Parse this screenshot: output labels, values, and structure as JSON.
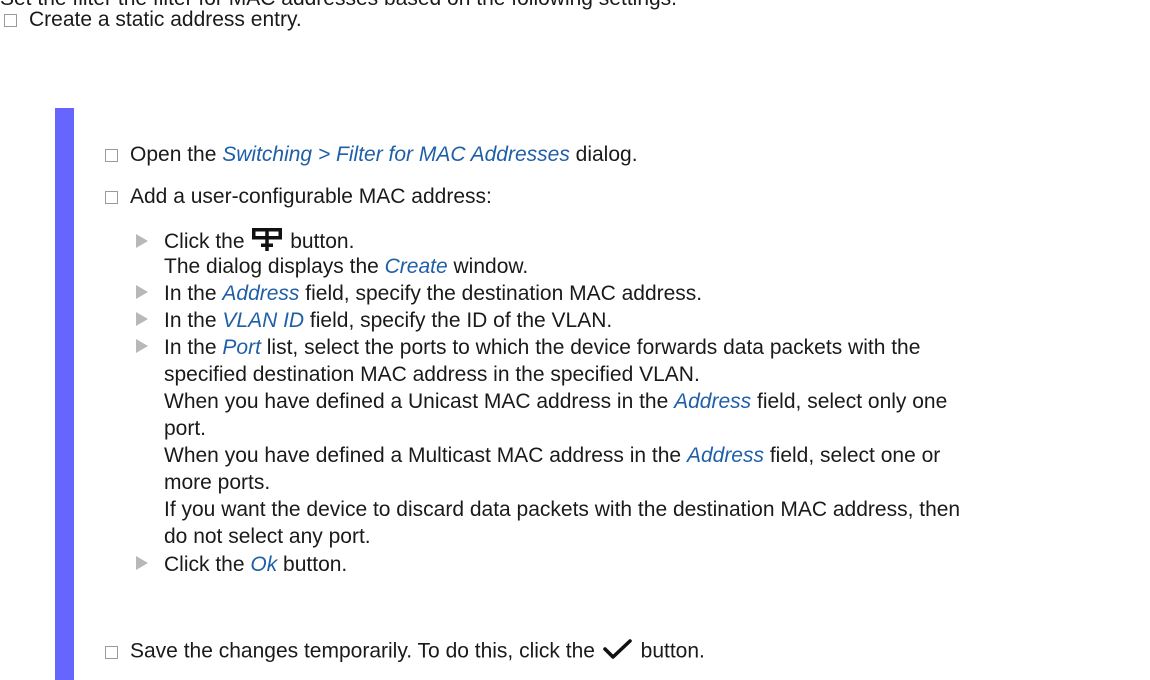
{
  "top_line": "Set the filter the filter for MAC addresses based on the following settings.",
  "task": "Create a static address entry.",
  "steps": {
    "open_dialog": {
      "pre": "Open the ",
      "link": "Switching > Filter for MAC Addresses",
      "post": " dialog."
    },
    "add_mac": "Add a user-configurable MAC address:",
    "save": {
      "pre": "Save the changes temporarily. To do this, click the ",
      "post": " button."
    }
  },
  "substeps": {
    "click_add": {
      "pre": "Click the ",
      "post": " button.",
      "icon": "add-row-icon"
    },
    "create_window": {
      "pre": "The dialog displays the ",
      "link": "Create",
      "post": " window."
    },
    "address": {
      "pre": "In the ",
      "link": "Address",
      "post": " field, specify the destination MAC address."
    },
    "vlan": {
      "pre": "In the ",
      "link": "VLAN ID",
      "post": " field, specify the ID of the VLAN."
    },
    "port": {
      "pre": "In the ",
      "link": "Port",
      "post": " list, select the ports to which the device forwards data packets with the",
      "line2": "specified destination MAC address in the specified VLAN.",
      "uni_pre": "When you have defined a Unicast MAC address in the ",
      "uni_link": "Address",
      "uni_post": " field, select only one",
      "uni_line2": "port.",
      "multi_pre": "When you have defined a Multicast MAC address in the ",
      "multi_link": "Address",
      "multi_post": " field, select one or",
      "multi_line2": "more ports.",
      "discard_line1": "If you want the device to discard data packets with the destination MAC address, then",
      "discard_line2": "do not select any port."
    },
    "ok": {
      "pre": "Click the ",
      "link": "Ok",
      "post": " button."
    }
  },
  "colors": {
    "bar": "#6666ff",
    "ui_link": "#1f5fa8",
    "arrow": "#b8b8b8"
  }
}
